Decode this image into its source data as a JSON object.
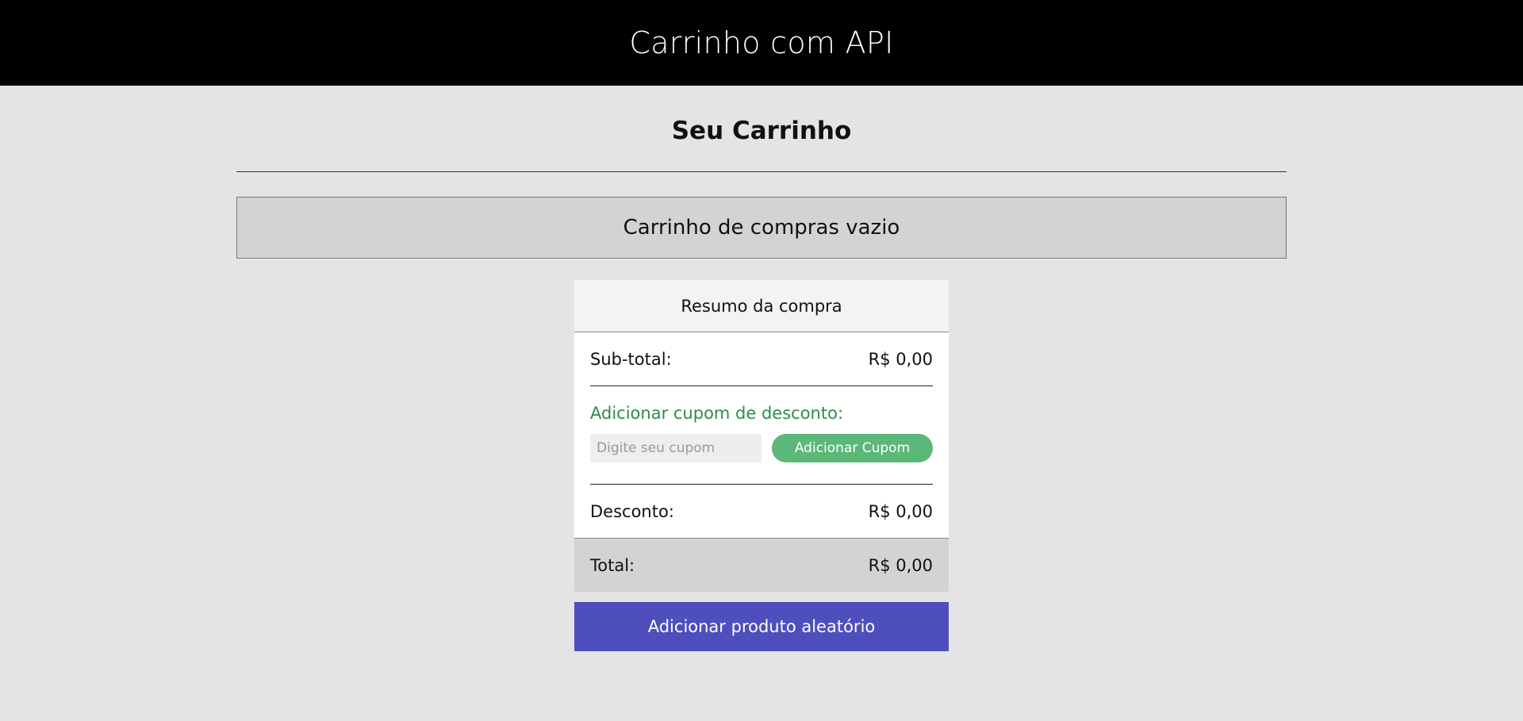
{
  "header": {
    "title": "Carrinho com API"
  },
  "cart": {
    "title": "Seu Carrinho",
    "empty_message": "Carrinho de compras vazio"
  },
  "summary": {
    "title": "Resumo da compra",
    "subtotal_label": "Sub-total:",
    "subtotal_value": "R$ 0,00",
    "coupon_title": "Adicionar cupom de desconto:",
    "coupon_placeholder": "Digite seu cupom",
    "coupon_value": "",
    "coupon_button": "Adicionar Cupom",
    "discount_label": "Desconto:",
    "discount_value": "R$ 0,00",
    "total_label": "Total:",
    "total_value": "R$ 0,00"
  },
  "actions": {
    "add_random_product": "Adicionar produto aleatório"
  },
  "colors": {
    "header_bg": "#000000",
    "page_bg": "#e4e4e4",
    "coupon_accent": "#2e8b47",
    "coupon_button_bg": "#5cb878",
    "primary_button_bg": "#4e4fbd"
  }
}
